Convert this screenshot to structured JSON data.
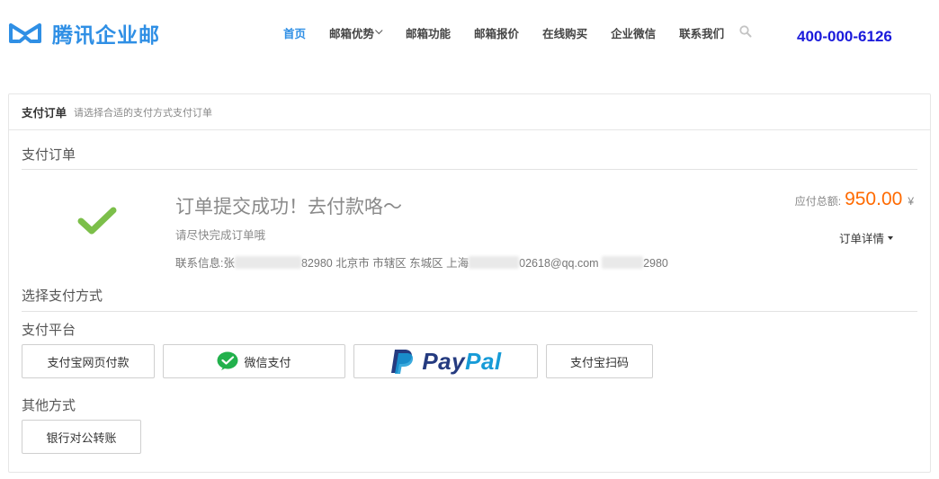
{
  "header": {
    "brand": "腾讯企业邮",
    "nav": [
      "首页",
      "邮箱优势",
      "邮箱功能",
      "邮箱报价",
      "在线购买",
      "企业微信",
      "联系我们"
    ],
    "phone": "400-000-6126",
    "brand_color": "#2f8fe5",
    "search_icon": "search-icon"
  },
  "panel": {
    "title": "支付订单",
    "subtitle": "请选择合适的支付方式支付订单",
    "order_section": "支付订单",
    "success_title": "订单提交成功！去付款咯～",
    "success_sub": "请尽快完成订单哦",
    "contact": {
      "label": "联系信息:张",
      "part1": "82980 北京市 市辖区 东城区 上海",
      "part2": "02618@qq.com",
      "part3": "2980"
    },
    "total_label": "应付总额:",
    "total_amount": "950.00",
    "total_unit": "¥",
    "order_details": "订单详情",
    "choose_method": "选择支付方式",
    "platform_title": "支付平台",
    "platforms": {
      "alipay_web": "支付宝网页付款",
      "wechat": "微信支付",
      "paypal_pay": "Pay",
      "paypal_pal": "Pal",
      "alipay_qr": "支付宝扫码"
    },
    "other_title": "其他方式",
    "bank_transfer": "银行对公转账",
    "accent_color": "#ff6a00",
    "success_color": "#7cbf4a"
  }
}
